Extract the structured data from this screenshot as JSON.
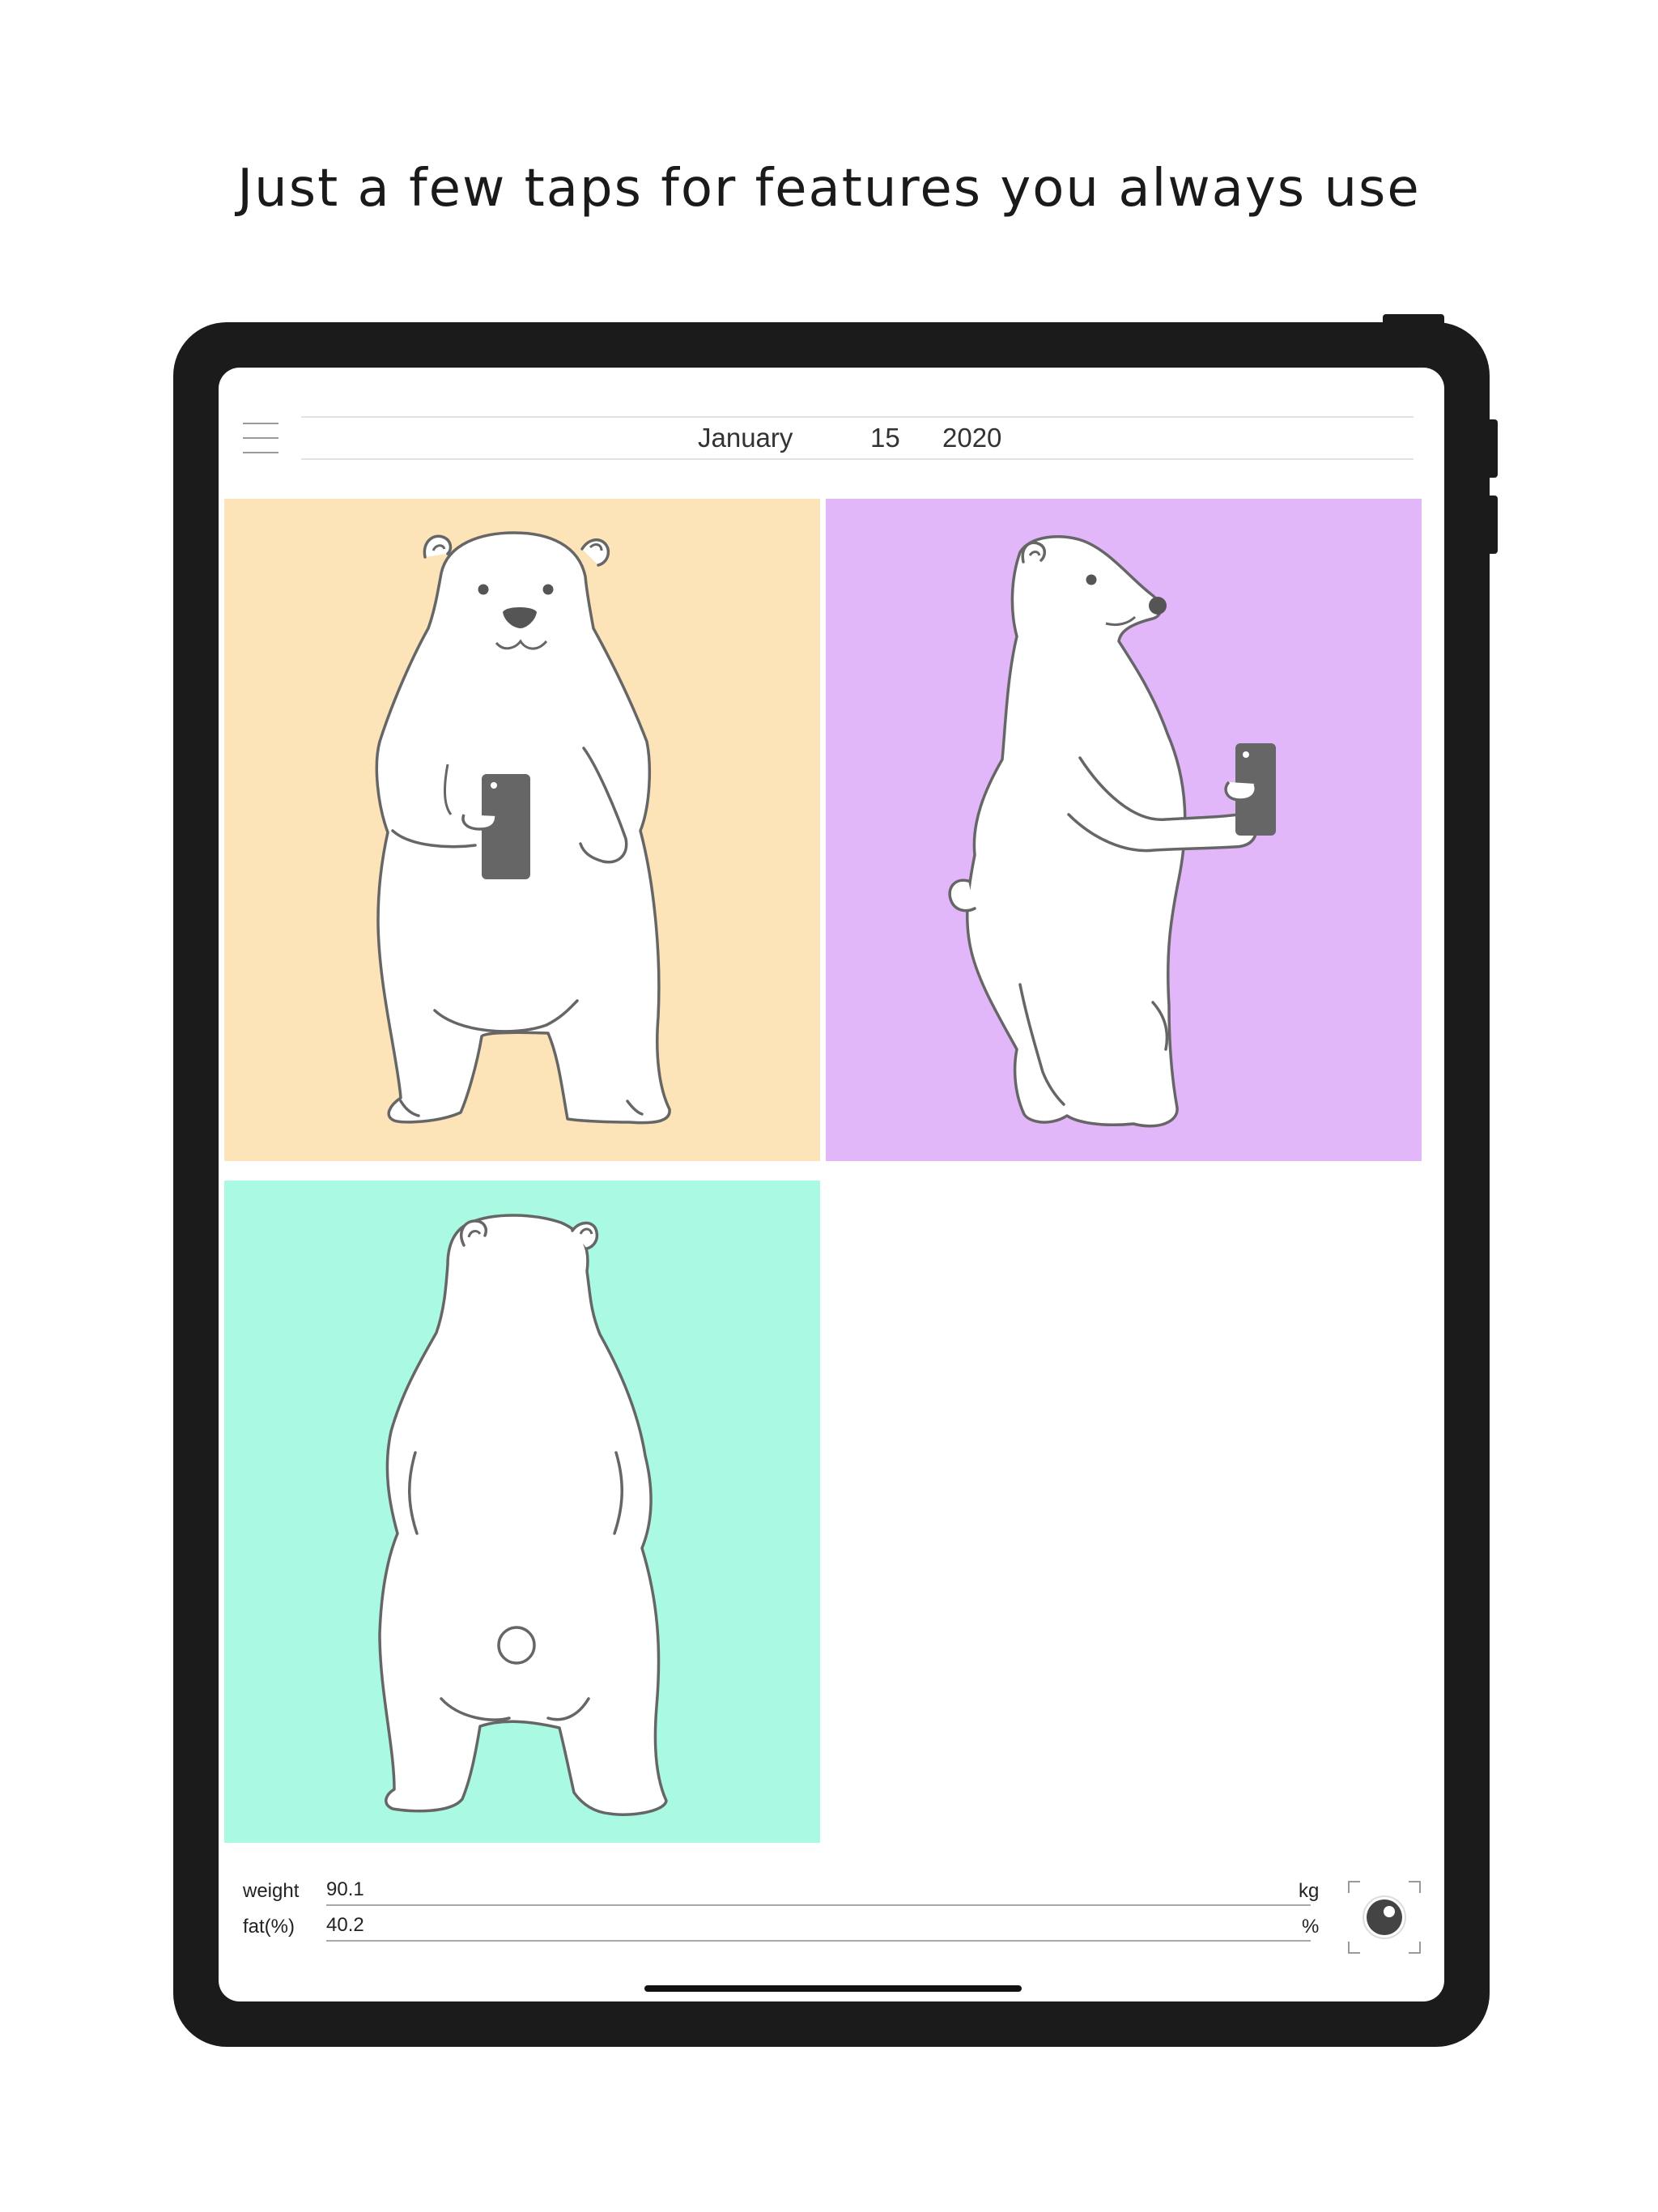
{
  "headline": "Just a few taps for features you always use",
  "header": {
    "menu_icon": "hamburger-menu-icon",
    "date": {
      "month": "January",
      "day": "15",
      "year": "2020"
    }
  },
  "photos": [
    {
      "pose": "front",
      "background": "#fde3b8"
    },
    {
      "pose": "side",
      "background": "#e1b7fa"
    },
    {
      "pose": "back",
      "background": "#aaf9e3"
    }
  ],
  "metrics": {
    "weight": {
      "label": "weight",
      "value": "90.1",
      "unit": "kg"
    },
    "fat": {
      "label": "fat(%)",
      "value": "40.2",
      "unit": "%"
    }
  },
  "camera_icon": "camera-capture-icon",
  "colors": {
    "device_frame": "#1b1b1b",
    "bear_outline": "#666666",
    "phone": "#666666"
  }
}
